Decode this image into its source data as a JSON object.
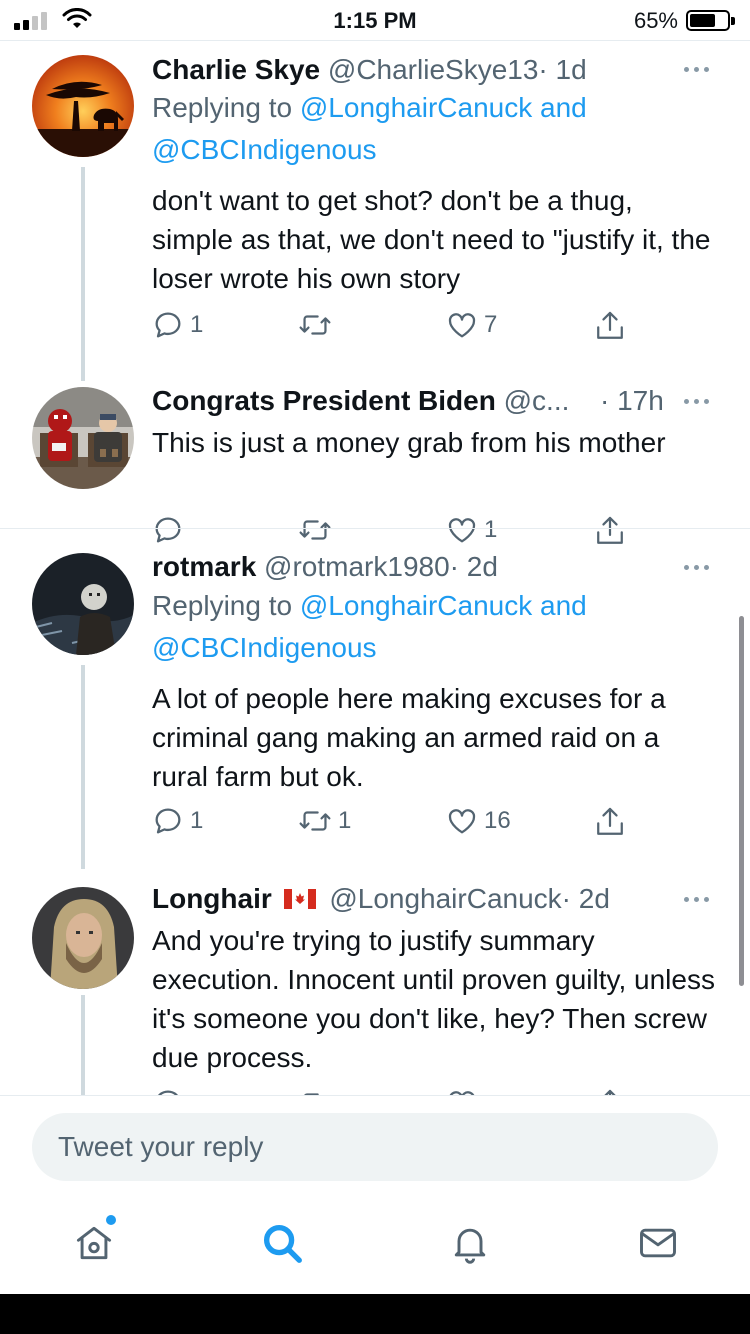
{
  "status_bar": {
    "time": "1:15 PM",
    "battery_percent": "65%",
    "battery_level": 0.65,
    "signal_bars_filled": 2,
    "signal_bars_total": 4
  },
  "tweets": [
    {
      "name": "Charlie Skye",
      "handle": "@CharlieSkye13",
      "time": "· 1d",
      "replying_prefix": "Replying to ",
      "replying_to": "@LonghairCanuck and",
      "replying_to_2": "@CBCIndigenous",
      "text": "don't want to get shot?  don't be a thug, simple as that, we don't need to \"justify it, the loser wrote his own story",
      "reply_count": "1",
      "retweet_count": "",
      "like_count": "7"
    },
    {
      "name": "Congrats President Biden",
      "handle": "@c...",
      "time": "· 17h",
      "text": "This is just a money grab from his mother",
      "reply_count": "",
      "retweet_count": "",
      "like_count": "1"
    },
    {
      "name": "rotmark",
      "handle": "@rotmark1980",
      "time": "· 2d",
      "replying_prefix": "Replying to ",
      "replying_to": "@LonghairCanuck and",
      "replying_to_2": "@CBCIndigenous",
      "text": "A lot of people here making excuses for a criminal gang making an armed raid on a rural farm but ok.",
      "reply_count": "1",
      "retweet_count": "1",
      "like_count": "16"
    },
    {
      "name": "Longhair",
      "flag": "canada-flag",
      "handle": "@LonghairCanuck",
      "time": "· 2d",
      "text": "And you're trying to justify summary execution. Innocent until proven guilty, unless it's someone you don't like, hey? Then screw due process."
    }
  ],
  "reply_box": {
    "placeholder": "Tweet your reply"
  },
  "tab_bar": {
    "items": [
      "home-icon",
      "search-icon",
      "notifications-icon",
      "messages-icon"
    ],
    "active": "search-icon"
  },
  "colors": {
    "accent": "#1d9bf0",
    "text": "#0f1419",
    "secondary": "#536471",
    "divider": "#e6ecf0"
  }
}
